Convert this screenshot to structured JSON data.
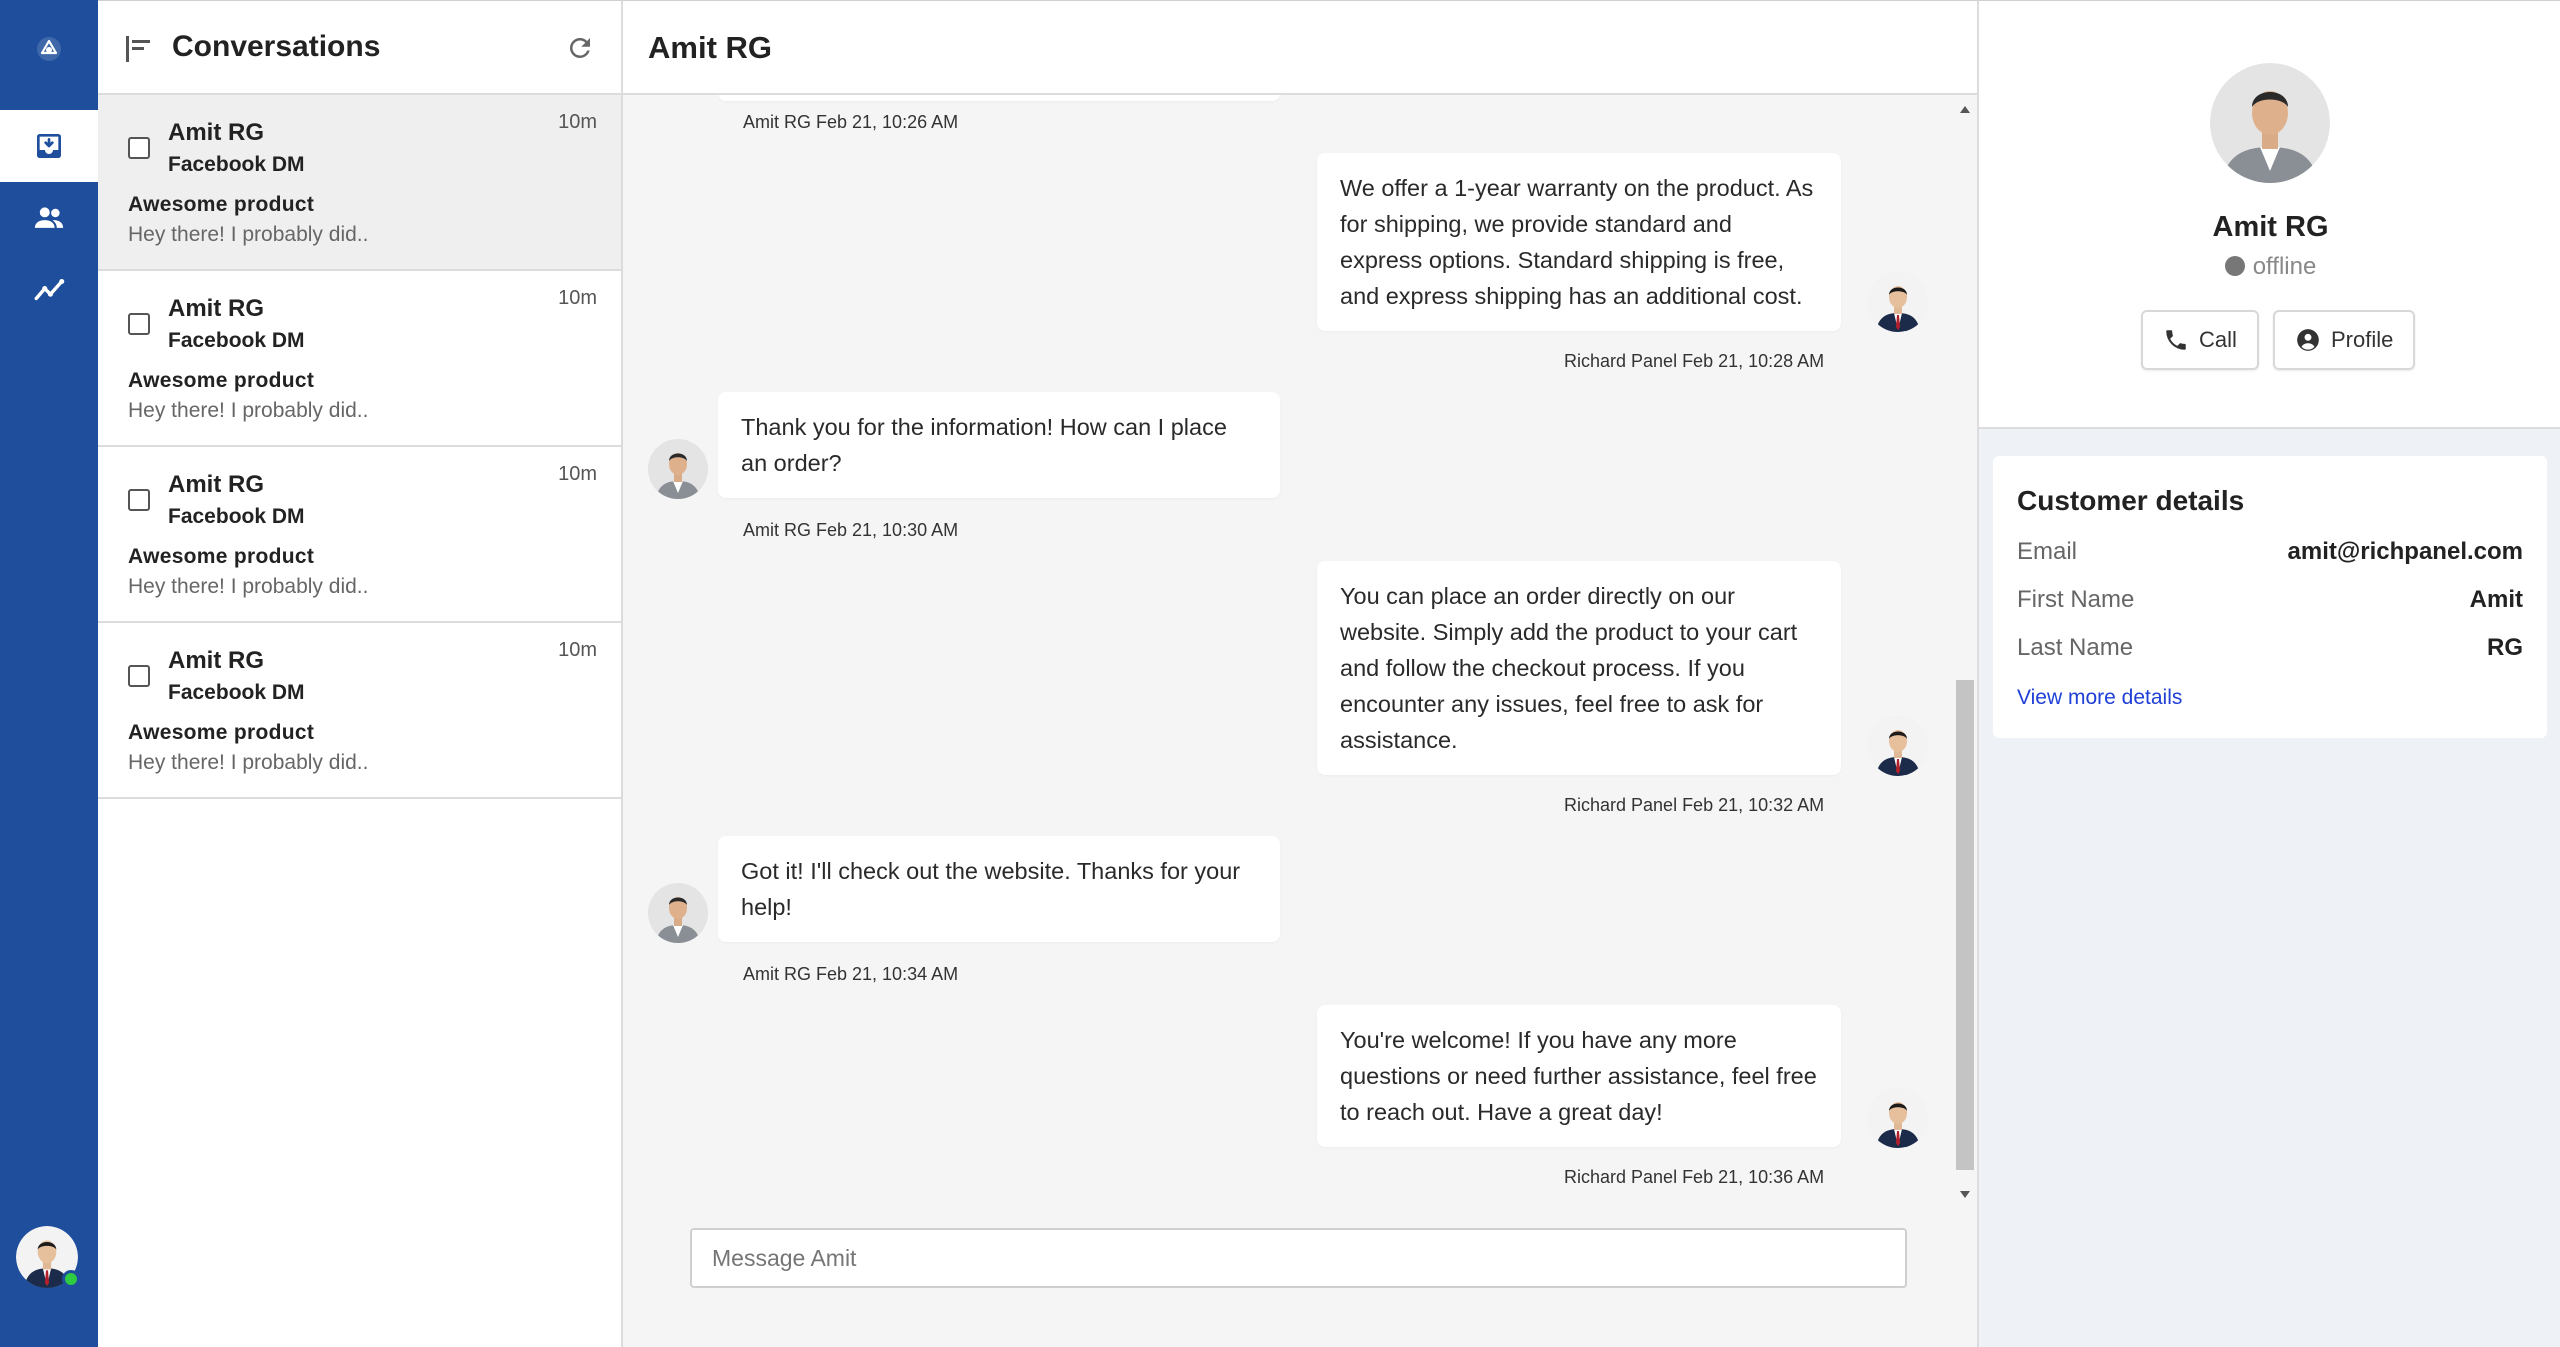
{
  "conversations": {
    "title": "Conversations",
    "items": [
      {
        "name": "Amit RG",
        "channel": "Facebook DM",
        "time": "10m",
        "subject": "Awesome product",
        "preview": "Hey there! I probably did.."
      },
      {
        "name": "Amit RG",
        "channel": "Facebook DM",
        "time": "10m",
        "subject": "Awesome product",
        "preview": "Hey there! I probably did.."
      },
      {
        "name": "Amit RG",
        "channel": "Facebook DM",
        "time": "10m",
        "subject": "Awesome product",
        "preview": "Hey there! I probably did.."
      },
      {
        "name": "Amit RG",
        "channel": "Facebook DM",
        "time": "10m",
        "subject": "Awesome product",
        "preview": "Hey there! I probably did.."
      }
    ]
  },
  "chat": {
    "title": "Amit RG",
    "messages": [
      {
        "meta": "Amit RG Feb 21, 10:26 AM"
      },
      {
        "text": "We offer a 1-year warranty on the product. As for shipping, we provide standard and express options. Standard shipping is free, and express shipping has an additional cost.",
        "meta": "Richard Panel Feb 21, 10:28 AM"
      },
      {
        "text": "Thank you for the information! How can I place an order?",
        "meta": "Amit RG Feb 21, 10:30 AM"
      },
      {
        "text": "You can place an order directly on our website. Simply add the product to your cart and follow the checkout process. If you encounter any issues, feel free to ask for assistance.",
        "meta": "Richard Panel Feb 21, 10:32 AM"
      },
      {
        "text": "Got it! I'll check out the website. Thanks for your help!",
        "meta": "Amit RG Feb 21, 10:34 AM"
      },
      {
        "text": "You're welcome! If you have any more questions or need further assistance, feel free to reach out. Have a great day!",
        "meta": "Richard Panel Feb 21, 10:36 AM"
      }
    ],
    "composer_placeholder": "Message Amit"
  },
  "profile": {
    "name": "Amit RG",
    "status": "offline",
    "call_label": "Call",
    "profile_label": "Profile",
    "details_title": "Customer details",
    "fields": [
      {
        "label": "Email",
        "value": "amit@richpanel.com"
      },
      {
        "label": "First Name",
        "value": "Amit"
      },
      {
        "label": "Last Name",
        "value": "RG"
      }
    ],
    "view_more": "View more details"
  },
  "colors": {
    "rail": "#1e4e9c",
    "online": "#2ecc40",
    "link": "#1f3fd6"
  }
}
